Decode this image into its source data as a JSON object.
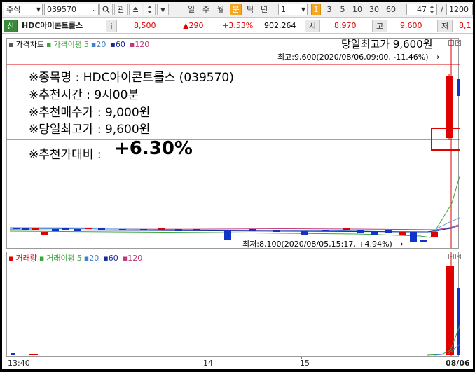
{
  "toolbar": {
    "market": "주식",
    "code": "039570",
    "search_icon": "search-icon",
    "gwan": "관",
    "periods": [
      "일",
      "주",
      "월",
      "분",
      "틱",
      "년"
    ],
    "active_period": "분",
    "interval_value": "1",
    "interval_badge": "1",
    "interval_options": [
      "3",
      "5",
      "10",
      "30",
      "60"
    ],
    "count_value": "47",
    "slash": "/",
    "total": "1200"
  },
  "quote": {
    "tag": "신",
    "name": "HDC아이콘트롤스",
    "info": "i",
    "price": "8,500",
    "change": "▲290",
    "change_rate": "+3.53%",
    "volume": "902,264",
    "open_label": "시",
    "open": "8,970",
    "high_label": "고",
    "high": "9,600",
    "low_label": "저",
    "low": "8,1"
  },
  "price_pane": {
    "title": "가격차트",
    "ma_title": "가격이평",
    "ma": [
      "5",
      "20",
      "60",
      "120"
    ],
    "ma_colors": [
      "#3aa63a",
      "#3a7fd0",
      "#1a2a9a",
      "#c03a7a"
    ],
    "top_label": "당일최고가 9,600원",
    "high_annotation": "최고:9,600(2020/08/06,09:00, -11.46%)⟶",
    "low_annotation": "최저:8,100(2020/08/05,15:17, +4.94%)⟶"
  },
  "info_box": {
    "line1": "※종목명 : HDC아이콘트롤스 (039570)",
    "line2": "※추천시간 : 9시00분",
    "line3": "※추천매수가 : 9,000원",
    "line4": "※당일최고가 : 9,600원",
    "line5_label": "※추천가대비 :",
    "line5_value": "+6.30%"
  },
  "volume_pane": {
    "title": "거래량",
    "ma_title": "거래이평",
    "ma": [
      "5",
      "20",
      "60",
      "120"
    ]
  },
  "x_axis": [
    "13:40",
    "14",
    "15",
    "08/06"
  ],
  "colors": {
    "up": "#e10000",
    "down": "#1033c8",
    "accent": "#f5a623"
  }
}
